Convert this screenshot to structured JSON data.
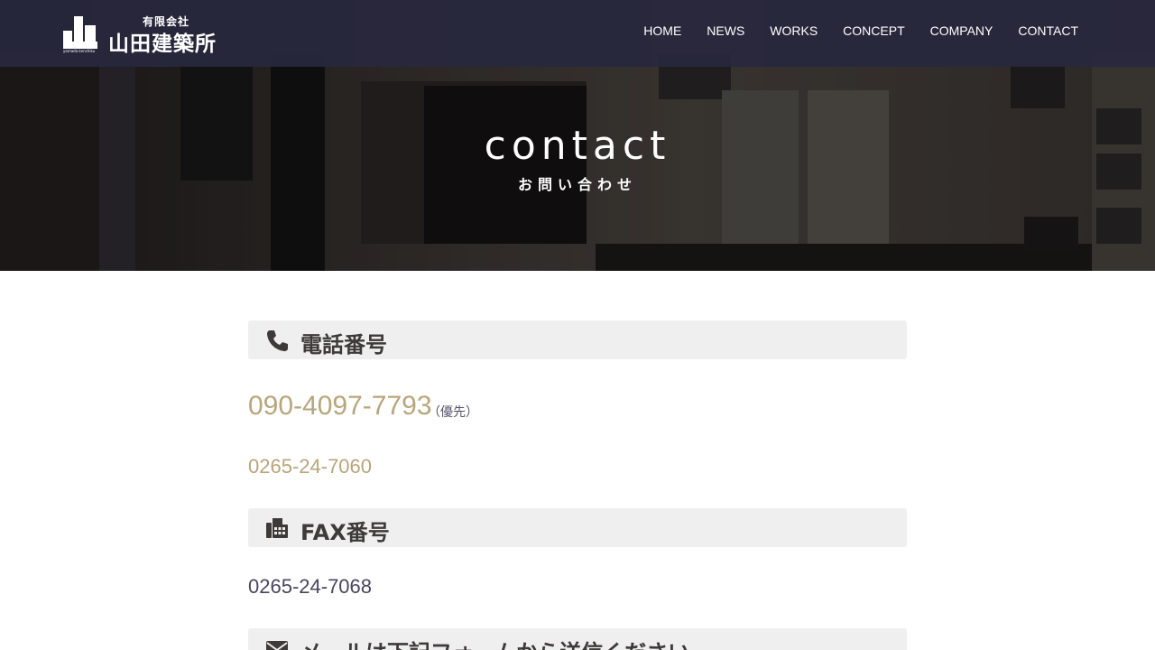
{
  "header": {
    "logo": {
      "company_type": "有限会社",
      "company_name": "山田建築所",
      "romaji": "yamada kenchiku"
    },
    "nav": [
      {
        "label": "HOME"
      },
      {
        "label": "NEWS"
      },
      {
        "label": "WORKS"
      },
      {
        "label": "CONCEPT"
      },
      {
        "label": "COMPANY"
      },
      {
        "label": "CONTACT"
      }
    ]
  },
  "hero": {
    "title": "contact",
    "subtitle": "お問い合わせ"
  },
  "sections": {
    "phone": {
      "icon": "phone-icon",
      "title": "電話番号",
      "primary": "090-4097-7793",
      "primary_note": "（優先）",
      "secondary": "0265-24-7060"
    },
    "fax": {
      "icon": "fax-icon",
      "title": "FAX番号",
      "number": "0265-24-7068"
    },
    "mail": {
      "icon": "envelope-icon",
      "title": "メールは下記フォームから送信ください"
    }
  },
  "colors": {
    "header_bg": "#28283e",
    "accent_gold": "#b8a57a",
    "section_bg": "#efefef",
    "text_dark": "#3f3a3a"
  }
}
